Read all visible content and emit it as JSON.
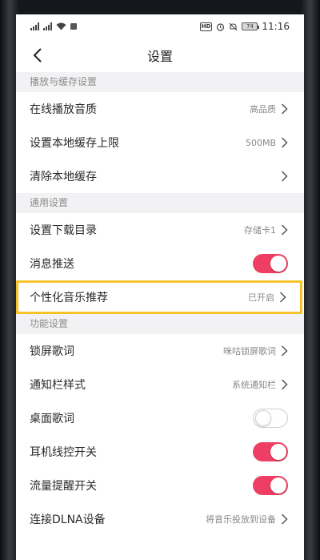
{
  "status_bar": {
    "time": "11:16",
    "battery": "74",
    "hd": "HD"
  },
  "header": {
    "title": "设置"
  },
  "sections": {
    "playback": {
      "title": "播放与缓存设置",
      "online_quality": {
        "label": "在线播放音质",
        "value": "高品质"
      },
      "cache_limit": {
        "label": "设置本地缓存上限",
        "value": "500MB"
      },
      "clear_cache": {
        "label": "清除本地缓存"
      }
    },
    "general": {
      "title": "通用设置",
      "download_dir": {
        "label": "设置下载目录",
        "value": "存储卡1"
      },
      "push": {
        "label": "消息推送",
        "on": true
      },
      "recommend": {
        "label": "个性化音乐推荐",
        "value": "已开启"
      }
    },
    "features": {
      "title": "功能设置",
      "lock_lyrics": {
        "label": "锁屏歌词",
        "value": "咪咕锁屏歌词"
      },
      "notif_style": {
        "label": "通知栏样式",
        "value": "系统通知栏"
      },
      "desktop_lyrics": {
        "label": "桌面歌词",
        "on": false
      },
      "headset": {
        "label": "耳机线控开关",
        "on": true
      },
      "traffic": {
        "label": "流量提醒开关",
        "on": true
      },
      "dlna": {
        "label": "连接DLNA设备",
        "value": "将音乐投放到设备"
      }
    }
  },
  "colors": {
    "accent": "#ee3e63",
    "highlight": "#f6c22b",
    "section_bg": "#f2f2f4"
  }
}
